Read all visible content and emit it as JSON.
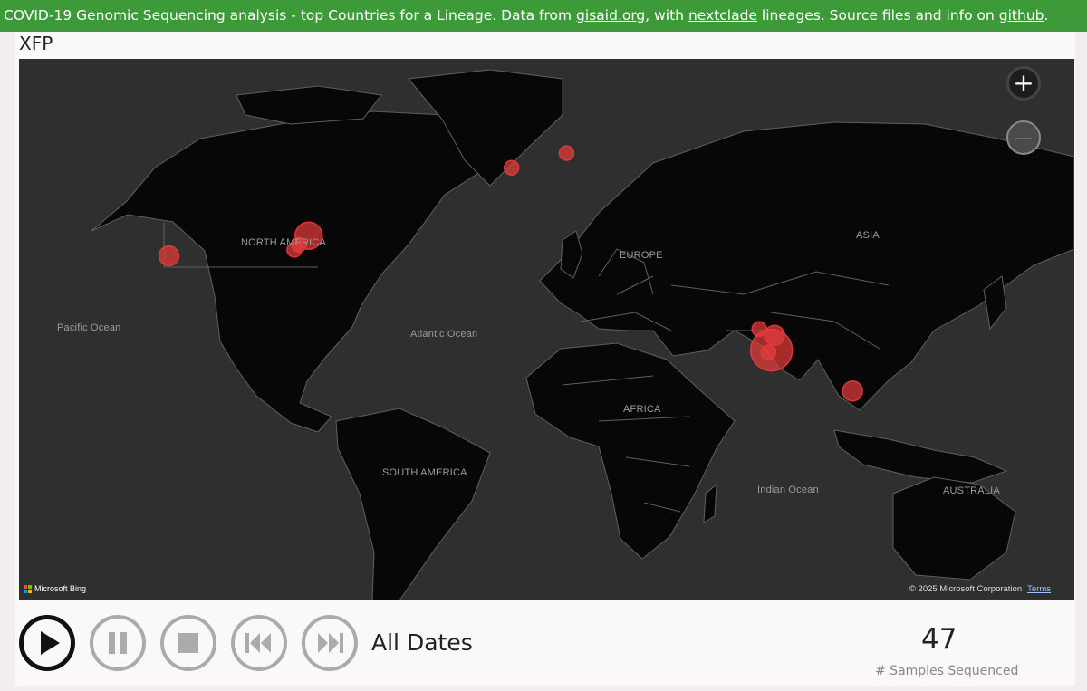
{
  "header": {
    "text_prefix": "COVID-19 Genomic Sequencing analysis - top Countries for a Lineage. Data from ",
    "link_gisaid": "gisaid.org",
    "text_middle": ", with ",
    "link_nextclade": "nextclade",
    "text_after": " lineages. Source files and info on ",
    "link_github": "github",
    "text_end": "."
  },
  "lineage_title": "XFP",
  "map": {
    "labels": {
      "north_america": "NORTH AMERICA",
      "pacific_ocean": "Pacific Ocean",
      "atlantic_ocean": "Atlantic Ocean",
      "europe": "EUROPE",
      "asia": "ASIA",
      "africa": "AFRICA",
      "south_america": "SOUTH AMERICA",
      "indian_ocean": "Indian Ocean",
      "australia": "AUSTRALIA"
    },
    "attribution": "Microsoft Bing",
    "copyright": "© 2025 Microsoft Corporation",
    "terms": "Terms",
    "zoom_in_symbol": "+",
    "zoom_out_symbol": "—",
    "bubble_color": "#e53b3b",
    "bubbles": [
      {
        "place": "California",
        "lat": 36.5,
        "lon": -119.5,
        "size": "medium"
      },
      {
        "place": "New York",
        "lat": 40.8,
        "lon": -73.8,
        "size": "large"
      },
      {
        "place": "Washington DC",
        "lat": 38.9,
        "lon": -77.0,
        "size": "small"
      },
      {
        "place": "Virginia",
        "lat": 37.8,
        "lon": -78.5,
        "size": "small"
      },
      {
        "place": "Ireland",
        "lat": 53.3,
        "lon": -7.5,
        "size": "small"
      },
      {
        "place": "Denmark",
        "lat": 55.6,
        "lon": 10.5,
        "size": "small"
      },
      {
        "place": "Maharashtra",
        "lat": 19.0,
        "lon": 73.5,
        "size": "small"
      },
      {
        "place": "Telangana",
        "lat": 17.4,
        "lon": 78.5,
        "size": "medium"
      },
      {
        "place": "Karnataka",
        "lat": 12.9,
        "lon": 76.5,
        "size": "small"
      },
      {
        "place": "India",
        "lat": 13.5,
        "lon": 77.5,
        "size": "xlarge"
      },
      {
        "place": "Singapore",
        "lat": 2.5,
        "lon": 104.0,
        "size": "medium"
      }
    ]
  },
  "playback": {
    "buttons": [
      "play",
      "pause",
      "stop",
      "previous",
      "next"
    ],
    "date_label": "All Dates"
  },
  "stats": {
    "value": "47",
    "label": "# Samples Sequenced"
  }
}
